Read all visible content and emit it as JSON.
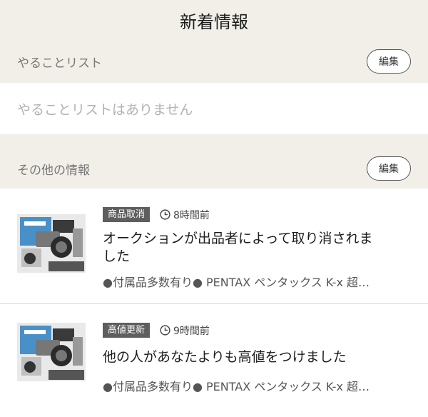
{
  "header": {
    "title": "新着情報"
  },
  "todo_section": {
    "label": "やることリスト",
    "edit_label": "編集",
    "empty_text": "やることリストはありません"
  },
  "other_section": {
    "label": "その他の情報",
    "edit_label": "編集"
  },
  "notifications": [
    {
      "badge": "商品取消",
      "time": "8時間前",
      "title_line1": "オークションが出品者によって取り消されま",
      "title_line2": "した",
      "item": "●付属品多数有り● PENTAX ペンタックス K-x 超…"
    },
    {
      "badge": "高値更新",
      "time": "9時間前",
      "title_line1": "他の人があなたよりも高値をつけました",
      "title_line2": "",
      "item": "●付属品多数有り● PENTAX ペンタックス K-x 超…"
    }
  ],
  "colors": {
    "background": "#f1efe8",
    "badge": "#5e5e5e",
    "placeholder_text": "#b2b2b2"
  }
}
